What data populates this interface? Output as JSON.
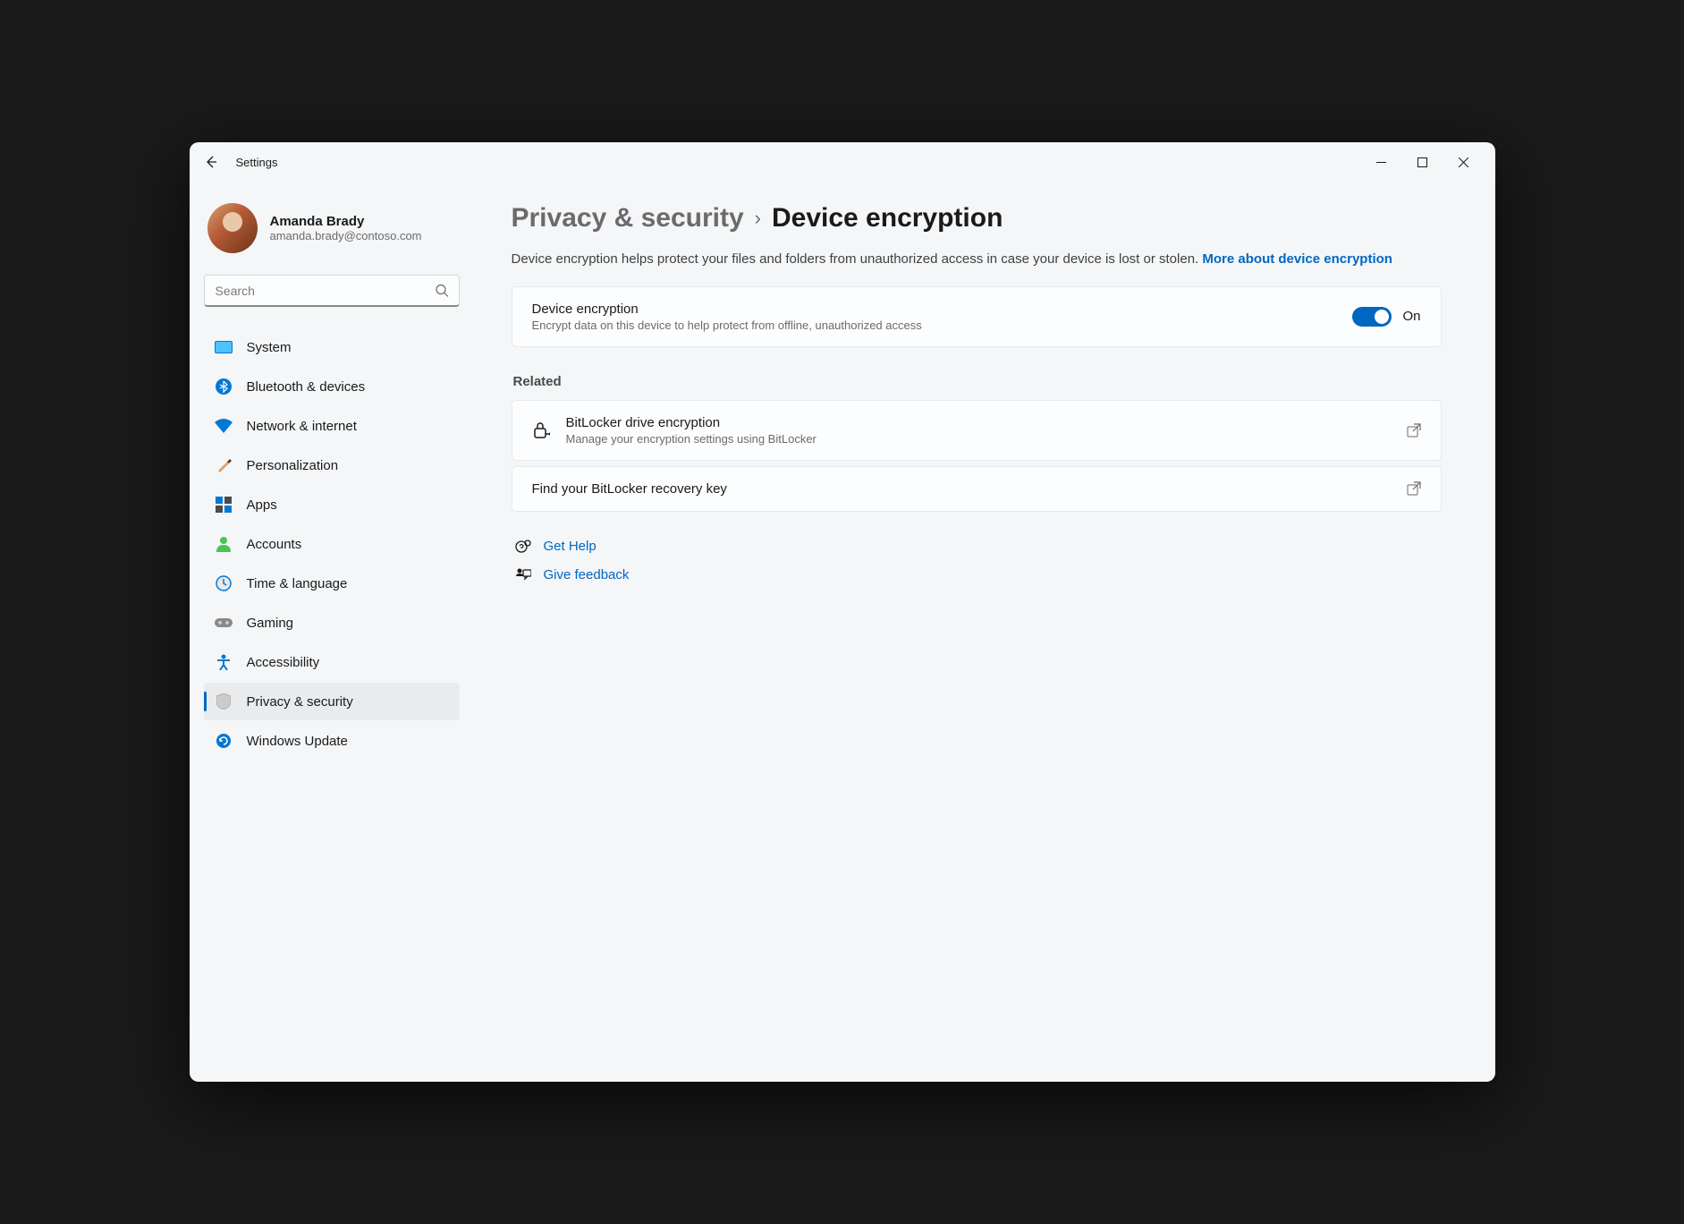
{
  "titlebar": {
    "title": "Settings"
  },
  "profile": {
    "name": "Amanda Brady",
    "email": "amanda.brady@contoso.com"
  },
  "search": {
    "placeholder": "Search"
  },
  "nav": {
    "items": [
      {
        "label": "System"
      },
      {
        "label": "Bluetooth & devices"
      },
      {
        "label": "Network & internet"
      },
      {
        "label": "Personalization"
      },
      {
        "label": "Apps"
      },
      {
        "label": "Accounts"
      },
      {
        "label": "Time & language"
      },
      {
        "label": "Gaming"
      },
      {
        "label": "Accessibility"
      },
      {
        "label": "Privacy & security"
      },
      {
        "label": "Windows Update"
      }
    ]
  },
  "breadcrumb": {
    "parent": "Privacy & security",
    "current": "Device encryption"
  },
  "description": {
    "text": "Device encryption helps protect your files and folders from unauthorized access in case your device is lost or stolen. ",
    "link": "More about device encryption"
  },
  "encryption": {
    "title": "Device encryption",
    "subtitle": "Encrypt data on this device to help protect from offline, unauthorized access",
    "state": "On"
  },
  "related": {
    "heading": "Related",
    "bitlocker": {
      "title": "BitLocker drive encryption",
      "subtitle": "Manage your encryption settings using BitLocker"
    },
    "recovery": {
      "title": "Find your BitLocker recovery key"
    }
  },
  "footer": {
    "help": "Get Help",
    "feedback": "Give feedback"
  }
}
